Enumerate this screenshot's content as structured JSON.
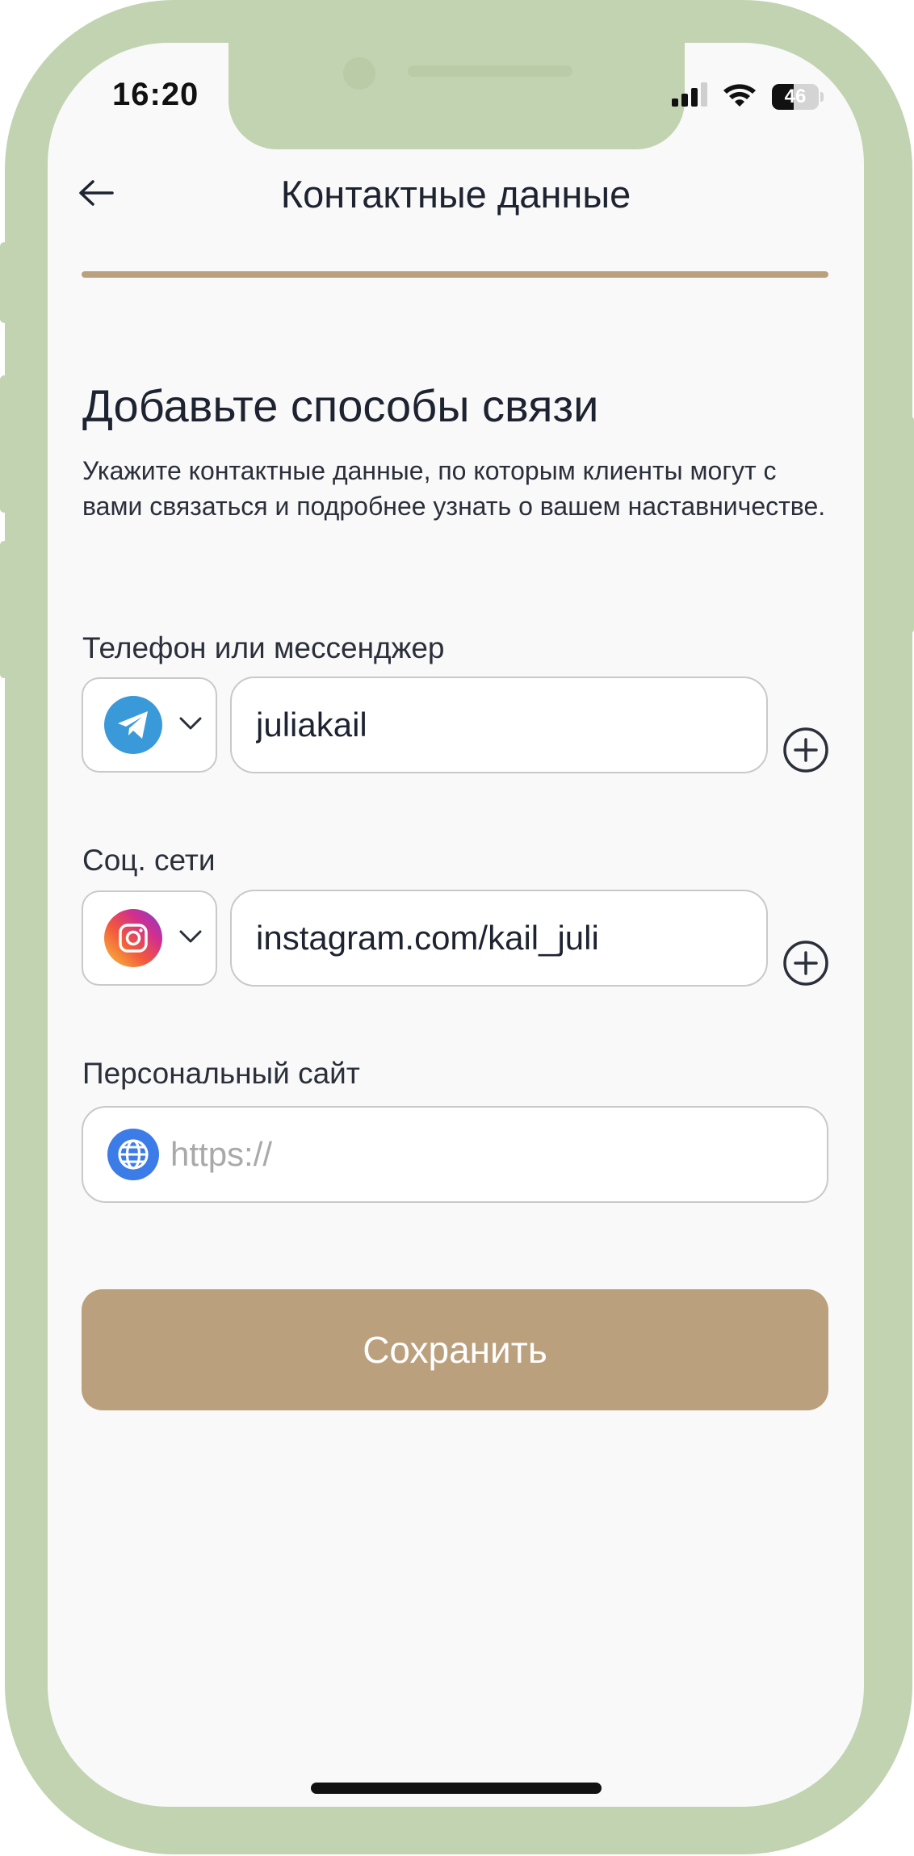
{
  "status_bar": {
    "time": "16:20",
    "battery_level": "46",
    "icons": [
      "cellular-signal-icon",
      "wifi-icon",
      "battery-icon"
    ]
  },
  "header": {
    "title": "Контактные данные",
    "back_icon": "arrow-left-icon",
    "progress_fraction": 1.0
  },
  "content": {
    "heading": "Добавьте способы связи",
    "description": "Укажите контактные данные, по которым клиенты могут с вами связаться и подробнее узнать о вашем наставничестве."
  },
  "phone_field": {
    "label": "Телефон или мессенджер",
    "selected_service": "telegram-icon",
    "value": "juliakail",
    "add_icon": "plus-circle-icon"
  },
  "social_field": {
    "label": "Соц. сети",
    "selected_service": "instagram-icon",
    "value": "instagram.com/kail_juli",
    "add_icon": "plus-circle-icon"
  },
  "website_field": {
    "label": "Персональный сайт",
    "placeholder": "https://",
    "value": "",
    "icon": "globe-icon"
  },
  "save_button": {
    "label": "Сохранить"
  },
  "colors": {
    "frame": "#c1d3b0",
    "accent": "#bba07d",
    "background": "#f9f9f9",
    "telegram": "#3a9ad9",
    "globe": "#3b7ce8"
  }
}
